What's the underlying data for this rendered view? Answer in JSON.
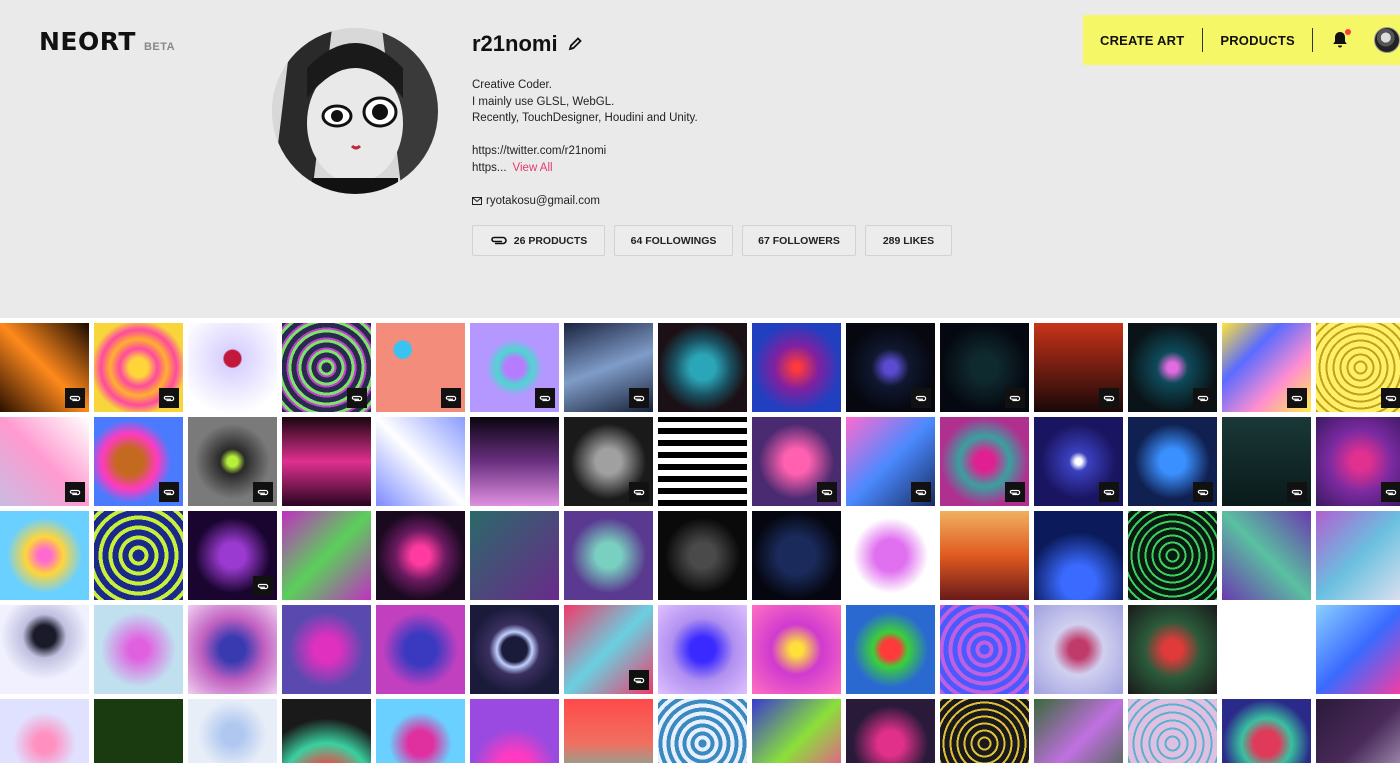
{
  "brand": {
    "name": "NEORT",
    "badge": "BETA"
  },
  "nav": {
    "create_art": "CREATE ART",
    "products": "PRODUCTS"
  },
  "profile": {
    "username": "r21nomi",
    "bio_lines": [
      "Creative Coder.",
      "I mainly use GLSL, WebGL.",
      "Recently, TouchDesigner, Houdini and Unity."
    ],
    "link_1": "https://twitter.com/r21nomi",
    "link_2": "https...",
    "view_all": "View All",
    "email": "ryotakosu@gmail.com"
  },
  "stats": {
    "products": "26 PRODUCTS",
    "followings": "64 FOLLOWINGS",
    "followers": "67 FOLLOWERS",
    "likes": "289 LIKES"
  },
  "colors": {
    "nav_bg": "#f6f766",
    "accent_link": "#e23c6c",
    "page_bg": "#eaeaea",
    "notification_dot": "#ff3b3b"
  },
  "icons": {
    "edit": "pencil-icon",
    "mail": "mail-icon",
    "products": "paperclip-icon",
    "notifications": "bell-icon"
  },
  "artworks": [
    {
      "bg": "linear-gradient(45deg,#2a1000,#ff8a1c,#1a0a00)",
      "badge": true
    },
    {
      "bg": "radial-gradient(circle,#ffd53a 15%,#ff4aa0 30%,#ffb030 45%,#ff4aa0 60%,#f7d53b 75%)",
      "badge": true
    },
    {
      "bg": "radial-gradient(circle at 50% 40%,#c2183c 12%,#d9d2ff 14%,#ffffff 80%)",
      "badge": false
    },
    {
      "bg": "repeating-radial-gradient(circle,#2a2a4e 0 5px,#7ee36a 5px 8px,#c040d0 8px 10px)",
      "badge": true
    },
    {
      "bg": "radial-gradient(circle at 30% 30%,#3ac3f0 10%,#f48c7c 11%)",
      "badge": true
    },
    {
      "bg": "radial-gradient(circle,#b77bff 15%,#4dd7d0 28%,#b497ff 45%)",
      "badge": true
    },
    {
      "bg": "linear-gradient(160deg,#1b2440,#7f9cc8,#162038)",
      "badge": true
    },
    {
      "bg": "radial-gradient(circle,#2aa6b8 20%,#1a5060 45%,#1b1015 70%)",
      "badge": false
    },
    {
      "bg": "radial-gradient(circle,#ff3a3a 5%,#8020a0 35%,#2040c0 70%)",
      "badge": false
    },
    {
      "bg": "radial-gradient(circle,#5b4bd0 10%,#101830 30%,#06070f 70%)",
      "badge": true
    },
    {
      "bg": "radial-gradient(circle,#0f2a2f 20%,#050810 70%)",
      "badge": true
    },
    {
      "bg": "linear-gradient(180deg,#c8331a,#1a0808)",
      "badge": true
    },
    {
      "bg": "radial-gradient(circle,#e36be0 8%,#0e4a5a 25%,#0a1418 70%)",
      "badge": true
    },
    {
      "bg": "linear-gradient(135deg,#ffe53a,#5a6bff,#ff8ed0,#fff04a)",
      "badge": true
    },
    {
      "bg": "repeating-radial-gradient(circle,#fff066 0 5px,#c0a020 5px 7px)",
      "badge": true
    },
    {
      "bg": "linear-gradient(45deg,#c9bce2,#ff9ad0,#ffffff)",
      "badge": true
    },
    {
      "bg": "radial-gradient(circle at 40% 50%,#c46a20 20%,#ff3ac0 40%,#4a7bff 60%)",
      "badge": true
    },
    {
      "bg": "radial-gradient(circle at 50% 50%,#b7f03a 8%,#2a2a2a 20%,#7a7a7a 60%)",
      "badge": true
    },
    {
      "bg": "linear-gradient(180deg,#1a0510,#e03090,#2a0520)",
      "badge": false
    },
    {
      "bg": "linear-gradient(45deg,#7b8bff,#ffffff,#8a9bff)",
      "badge": false
    },
    {
      "bg": "linear-gradient(180deg,#0a0510,#6a3080,#e090e0)",
      "badge": false
    },
    {
      "bg": "radial-gradient(circle,#a0a0a0 20%,#1a1a1a 60%)",
      "badge": true
    },
    {
      "bg": "repeating-linear-gradient(0deg,#000 0 6px,#fff 6px 12px)",
      "badge": false
    },
    {
      "bg": "radial-gradient(circle,#ff60b0 20%,#4a2a70 60%)",
      "badge": true
    },
    {
      "bg": "linear-gradient(135deg,#ff6ad0,#4a8aff,#1a2a60)",
      "badge": true
    },
    {
      "bg": "radial-gradient(circle,#e02090 15%,#3aa0a0 40%,#b03090 70%)",
      "badge": true
    },
    {
      "bg": "radial-gradient(circle,#ffffff 5%,#3a40c0 15%,#1a1560 60%)",
      "badge": true
    },
    {
      "bg": "radial-gradient(circle,#3a90ff 20%,#102050 60%)",
      "badge": true
    },
    {
      "bg": "linear-gradient(180deg,#1a3838,#0a1a1a)",
      "badge": true
    },
    {
      "bg": "radial-gradient(circle,#e03090 15%,#7a2aa0 50%,#3a1a60)",
      "badge": true
    },
    {
      "bg": "radial-gradient(circle,#ff6ad0 10%,#ffd53a 30%,#6ad0ff 60%)",
      "badge": false
    },
    {
      "bg": "repeating-radial-gradient(circle,#1a2a8a 0 6px,#c8f03a 6px 10px)",
      "badge": false
    },
    {
      "bg": "radial-gradient(circle,#9a3ad0 20%,#1a0530 60%)",
      "badge": true
    },
    {
      "bg": "linear-gradient(135deg,#c030c0,#5ad05a,#c030c0)",
      "badge": false
    },
    {
      "bg": "radial-gradient(circle,#ff3aa0 15%,#6a1a60 40%,#1a0a20 70%)",
      "badge": false
    },
    {
      "bg": "linear-gradient(135deg,#2a6a6a,#6a2a8a)",
      "badge": false
    },
    {
      "bg": "radial-gradient(circle,#7ad0c0 20%,#5a3a90 60%)",
      "badge": false
    },
    {
      "bg": "radial-gradient(circle,#4a4a4a 20%,#0a0a0a 60%)",
      "badge": false
    },
    {
      "bg": "radial-gradient(circle,#1a2a5a 30%,#05060f 70%)",
      "badge": false
    },
    {
      "bg": "radial-gradient(circle,#e070f0 25%,#ffffff 60%)",
      "badge": false
    },
    {
      "bg": "linear-gradient(180deg,#f0b060,#e05a20,#6a1a1a)",
      "badge": false
    },
    {
      "bg": "radial-gradient(circle at 50% 80%,#3a6aff 20%,#0a1a5a 60%)",
      "badge": false
    },
    {
      "bg": "repeating-radial-gradient(circle,#0a1a10 0 5px,#3ad060 5px 7px)",
      "badge": false
    },
    {
      "bg": "linear-gradient(45deg,#6a3ab0,#5ac0a0,#6a3ab0)",
      "badge": false
    },
    {
      "bg": "linear-gradient(135deg,#b060d0,#6ac0e0,#e0e0f0)",
      "badge": false
    },
    {
      "bg": "radial-gradient(circle at 50% 35%,#1a1a2a 15%,#c0c0e0 30%,#f0f0ff 60%)",
      "badge": false
    },
    {
      "bg": "radial-gradient(circle,#e060e0 15%,#c0e0f0 60%)",
      "badge": false
    },
    {
      "bg": "radial-gradient(circle,#3a3ab0 20%,#c060c0 50%,#f0d0f0)",
      "badge": false
    },
    {
      "bg": "radial-gradient(circle,#e030c0 20%,#5a4ab0 60%)",
      "badge": false
    },
    {
      "bg": "radial-gradient(circle,#3a3ac0 25%,#c040c0 60%)",
      "badge": false
    },
    {
      "bg": "radial-gradient(circle,#1a1a3a 20%,#c0d0ff 28%,#3a3060 40%,#1a1a3a 70%)",
      "badge": false
    },
    {
      "bg": "linear-gradient(135deg,#f03a6a,#6ad0e0,#f03a6a)",
      "badge": true
    },
    {
      "bg": "radial-gradient(circle,#3a2aff 20%,#b090f0 50%,#e0c0ff)",
      "badge": false
    },
    {
      "bg": "radial-gradient(circle,#ffe03a 10%,#d03ad0 40%,#ff70c0)",
      "badge": false
    },
    {
      "bg": "radial-gradient(circle,#ff3a3a 15%,#3ad03a 28%,#2a6ad0 60%)",
      "badge": false
    },
    {
      "bg": "repeating-radial-gradient(circle,#4a5aff 0 5px,#c060e0 5px 9px)",
      "badge": false
    },
    {
      "bg": "radial-gradient(circle,#c03a6a 15%,#d0d0f0 40%,#a0a0e0)",
      "badge": false
    },
    {
      "bg": "radial-gradient(circle,#e03a3a 15%,#2a5a3a 45%,#1a1a1a)",
      "badge": false
    },
    {
      "bg": "linear-gradient(#ffffff,#ffffff)",
      "badge": false
    },
    {
      "bg": "linear-gradient(135deg,#8ad0ff,#3a6aff,#ff3aa0)",
      "badge": false
    },
    {
      "bg": "radial-gradient(circle,#ff90c0 15%,#e0e0ff 50%)",
      "badge": false
    },
    {
      "bg": "linear-gradient(#1a3a10,#1a3a10)",
      "badge": false
    },
    {
      "bg": "radial-gradient(circle at 50% 40%,#b0c8f0 15%,#e8eef8 50%)",
      "badge": false
    },
    {
      "bg": "radial-gradient(circle at 50% 100%,#ff3a3a 20%,#3ad0a0 45%,#1a1a1a 70%)",
      "badge": false
    },
    {
      "bg": "radial-gradient(circle,#e030a0 20%,#6ad0ff 50%)",
      "badge": false
    },
    {
      "bg": "radial-gradient(circle at 50% 80%,#ff3ac0 20%,#9a4ae0 50%)",
      "badge": false
    },
    {
      "bg": "linear-gradient(180deg,#ff4a4a,#f07060,#3ad0c0)",
      "badge": false
    },
    {
      "bg": "repeating-radial-gradient(circle,#3a8ac0 0 4px,#e8f0ff 4px 8px)",
      "badge": false
    },
    {
      "bg": "linear-gradient(135deg,#3a3ad0,#8ae03a,#ff3aa0)",
      "badge": false
    },
    {
      "bg": "radial-gradient(circle,#e0308a 20%,#2a1a3a 60%)",
      "badge": false
    },
    {
      "bg": "repeating-radial-gradient(circle,#1a1a1a 0 5px,#e0c03a 5px 7px)",
      "badge": false
    },
    {
      "bg": "linear-gradient(135deg,#3a6a3a,#c070e0,#3a6a3a)",
      "badge": false
    },
    {
      "bg": "repeating-radial-gradient(circle,#e0c0e0 0 6px,#5ab0d0 6px 8px)",
      "badge": false
    },
    {
      "bg": "radial-gradient(circle,#e03a5a 20%,#3ac0a0 40%,#2a2a8a 70%)",
      "badge": false
    },
    {
      "bg": "linear-gradient(135deg,#2a1a3a,#4a2a5a,#c0b0d0)",
      "badge": false
    }
  ]
}
